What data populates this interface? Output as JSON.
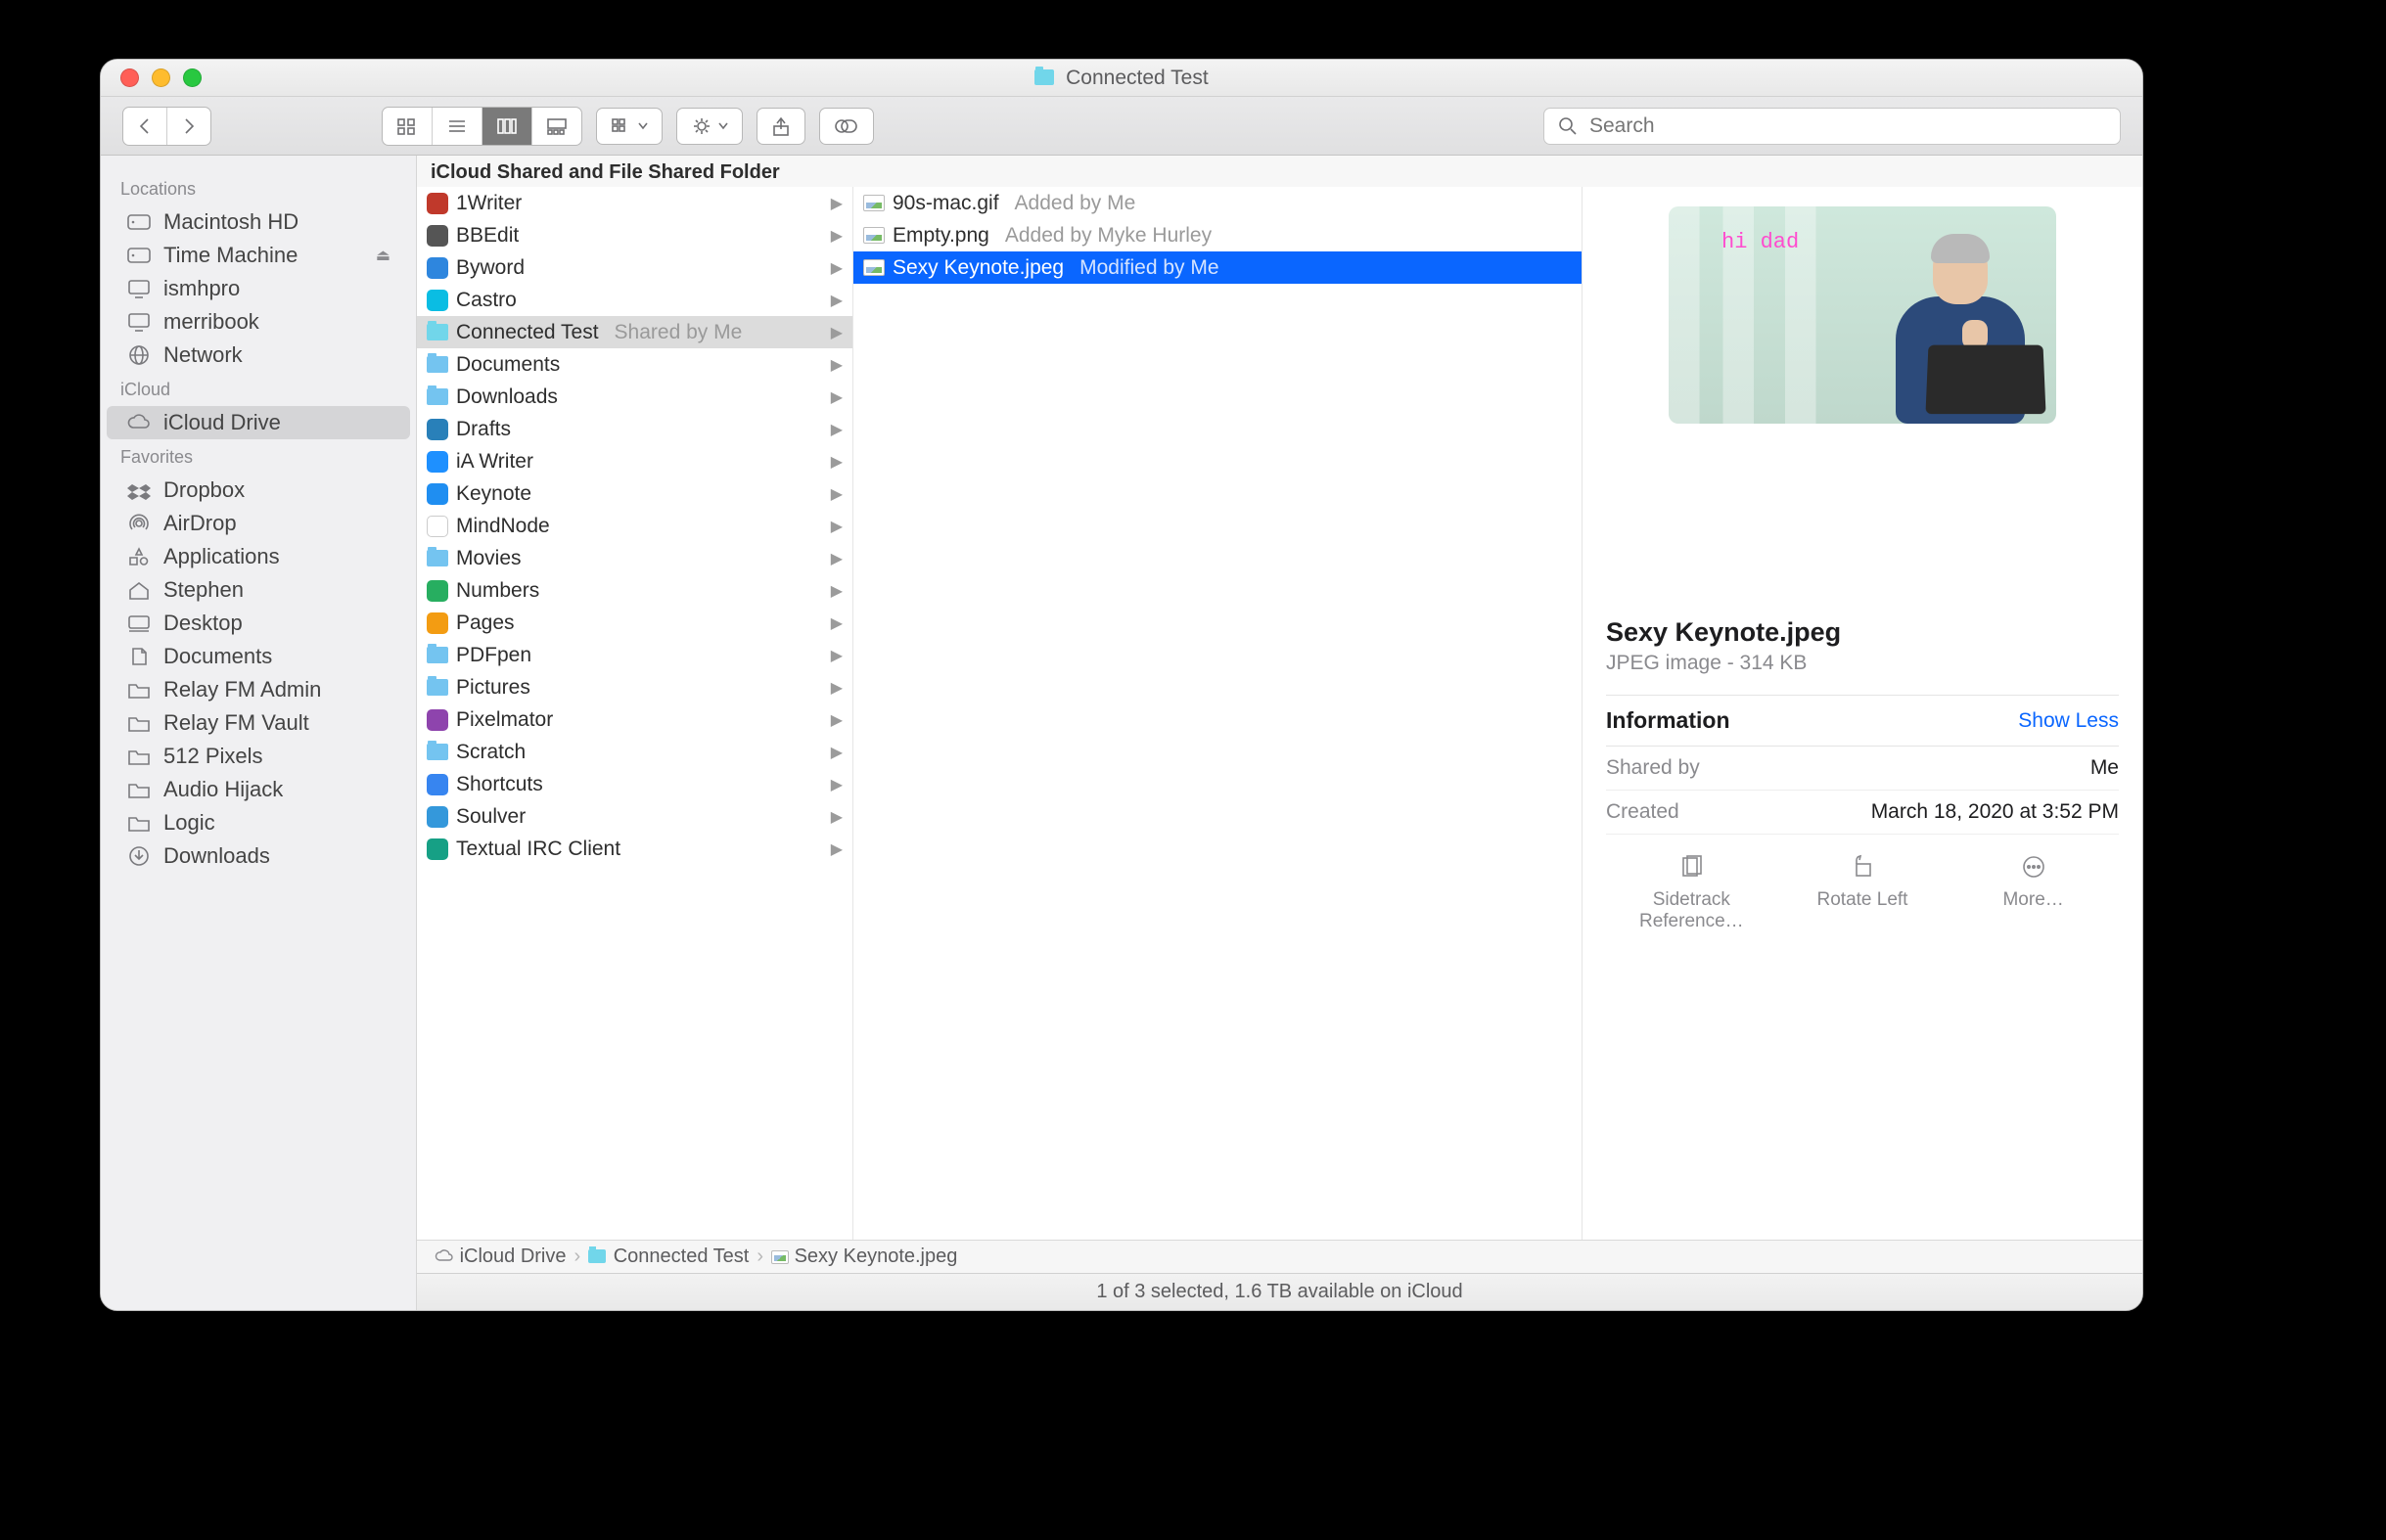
{
  "window": {
    "title": "Connected Test"
  },
  "toolbar": {
    "search_placeholder": "Search"
  },
  "sidebar": {
    "sections": [
      {
        "header": "Locations",
        "items": [
          {
            "label": "Macintosh HD",
            "icon": "hdd"
          },
          {
            "label": "Time Machine",
            "icon": "hdd-ext",
            "eject": true
          },
          {
            "label": "ismhpro",
            "icon": "monitor"
          },
          {
            "label": "merribook",
            "icon": "monitor"
          },
          {
            "label": "Network",
            "icon": "globe"
          }
        ]
      },
      {
        "header": "iCloud",
        "items": [
          {
            "label": "iCloud Drive",
            "icon": "cloud",
            "selected": true
          }
        ]
      },
      {
        "header": "Favorites",
        "items": [
          {
            "label": "Dropbox",
            "icon": "dropbox"
          },
          {
            "label": "AirDrop",
            "icon": "airdrop"
          },
          {
            "label": "Applications",
            "icon": "apps"
          },
          {
            "label": "Stephen",
            "icon": "home"
          },
          {
            "label": "Desktop",
            "icon": "desktop"
          },
          {
            "label": "Documents",
            "icon": "doc"
          },
          {
            "label": "Relay FM Admin",
            "icon": "folder"
          },
          {
            "label": "Relay FM Vault",
            "icon": "folder"
          },
          {
            "label": "512 Pixels",
            "icon": "folder"
          },
          {
            "label": "Audio Hijack",
            "icon": "folder"
          },
          {
            "label": "Logic",
            "icon": "folder"
          },
          {
            "label": "Downloads",
            "icon": "download"
          }
        ]
      }
    ]
  },
  "column_header": "iCloud Shared and File Shared Folder",
  "col1": [
    {
      "name": "1Writer",
      "icon": "app",
      "color": "#c0392b"
    },
    {
      "name": "BBEdit",
      "icon": "app",
      "color": "#555"
    },
    {
      "name": "Byword",
      "icon": "app",
      "color": "#2e86de"
    },
    {
      "name": "Castro",
      "icon": "app",
      "color": "#0abde3"
    },
    {
      "name": "Connected Test",
      "icon": "shared-folder",
      "subtext": "Shared by Me",
      "selected": true
    },
    {
      "name": "Documents",
      "icon": "folder"
    },
    {
      "name": "Downloads",
      "icon": "folder"
    },
    {
      "name": "Drafts",
      "icon": "app",
      "color": "#2980b9"
    },
    {
      "name": "iA Writer",
      "icon": "app",
      "color": "#1e90ff"
    },
    {
      "name": "Keynote",
      "icon": "app",
      "color": "#1f8ef1"
    },
    {
      "name": "MindNode",
      "icon": "app",
      "color": "#fff",
      "border": true
    },
    {
      "name": "Movies",
      "icon": "folder"
    },
    {
      "name": "Numbers",
      "icon": "app",
      "color": "#27ae60"
    },
    {
      "name": "Pages",
      "icon": "app",
      "color": "#f39c12"
    },
    {
      "name": "PDFpen",
      "icon": "folder"
    },
    {
      "name": "Pictures",
      "icon": "folder"
    },
    {
      "name": "Pixelmator",
      "icon": "app",
      "color": "#8e44ad"
    },
    {
      "name": "Scratch",
      "icon": "folder"
    },
    {
      "name": "Shortcuts",
      "icon": "app",
      "color": "#3785f0"
    },
    {
      "name": "Soulver",
      "icon": "app",
      "color": "#3498db"
    },
    {
      "name": "Textual IRC Client",
      "icon": "app",
      "color": "#16a085"
    }
  ],
  "col2": [
    {
      "name": "90s-mac.gif",
      "icon": "image",
      "subtext": "Added by Me"
    },
    {
      "name": "Empty.png",
      "icon": "image",
      "subtext": "Added by Myke Hurley"
    },
    {
      "name": "Sexy Keynote.jpeg",
      "icon": "image",
      "subtext": "Modified by Me",
      "selected": true
    }
  ],
  "preview": {
    "thumb_text": "hi dad",
    "name": "Sexy Keynote.jpeg",
    "kind": "JPEG image - 314 KB",
    "info_label": "Information",
    "info_toggle": "Show Less",
    "rows": [
      {
        "k": "Shared by",
        "v": "Me"
      },
      {
        "k": "Created",
        "v": "March 18, 2020 at 3:52 PM"
      }
    ],
    "actions": [
      {
        "label": "Sidetrack Reference…"
      },
      {
        "label": "Rotate Left"
      },
      {
        "label": "More…"
      }
    ]
  },
  "pathbar": [
    {
      "label": "iCloud Drive",
      "icon": "cloud"
    },
    {
      "label": "Connected Test",
      "icon": "shared-folder"
    },
    {
      "label": "Sexy Keynote.jpeg",
      "icon": "image"
    }
  ],
  "status": "1 of 3 selected, 1.6 TB available on iCloud"
}
